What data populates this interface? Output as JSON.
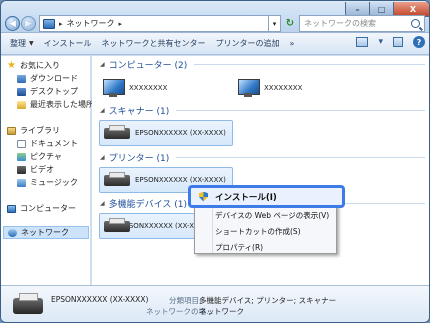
{
  "address": {
    "crumbs": [
      "ネットワーク"
    ],
    "separator": "▸"
  },
  "search": {
    "placeholder": "ネットワークの検索"
  },
  "toolbar": {
    "items": [
      "整理",
      "インストール",
      "ネットワークと共有センター",
      "プリンターの追加",
      "»"
    ]
  },
  "sidebar": {
    "favorites": "お気に入り",
    "downloads": "ダウンロード",
    "desktop": "デスクトップ",
    "recent": "最近表示した場所",
    "libraries": "ライブラリ",
    "documents": "ドキュメント",
    "pictures": "ピクチャ",
    "videos": "ビデオ",
    "music": "ミュージック",
    "computer": "コンピューター",
    "network": "ネットワーク"
  },
  "groups": {
    "computers": {
      "title": "コンピューター (2)",
      "items": [
        "XXXXXXXX",
        "XXXXXXXX"
      ]
    },
    "scanners": {
      "title": "スキャナー (1)",
      "items": [
        "EPSONXXXXXX (XX-XXXX)"
      ]
    },
    "printers": {
      "title": "プリンター (1)",
      "items": [
        "EPSONXXXXXX (XX-XXXX)"
      ]
    },
    "mfp": {
      "title": "多機能デバイス (1)",
      "items": [
        "EPSONXXXXXX (XX-X"
      ]
    }
  },
  "context_menu": {
    "install": "インストール(I)",
    "webpage": "デバイスの Web ページの表示(V)",
    "shortcut": "ショートカットの作成(S)",
    "properties": "プロパティ(R)"
  },
  "details": {
    "name": "EPSONXXXXXX (XX-XXXX)",
    "category_label": "分類項目:",
    "category_value": "多機能デバイス; プリンター; スキャナー",
    "location_label": "ネットワークの場...",
    "location_value": "ネットワーク"
  },
  "window_controls": {
    "minimize": "–",
    "maximize": "□",
    "close": "X"
  },
  "colors": {
    "accent": "#3e7be8",
    "group_title": "#1f4f99"
  }
}
